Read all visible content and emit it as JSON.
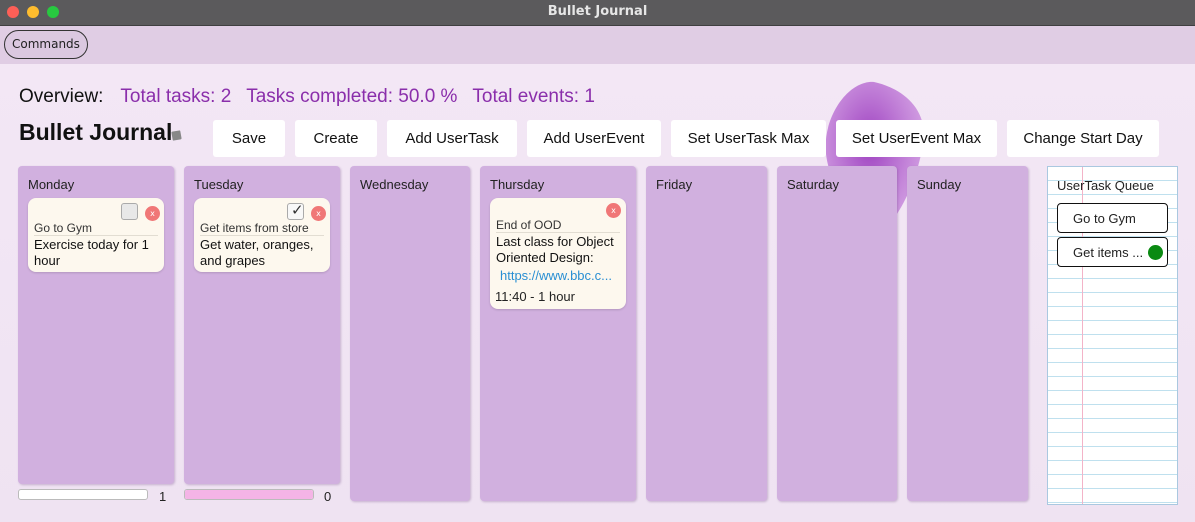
{
  "window": {
    "title": "Bullet Journal"
  },
  "menubar": {
    "commands_label": "Commands"
  },
  "overview": {
    "label": "Overview:",
    "total_tasks": "Total tasks: 2",
    "tasks_completed": "Tasks completed: 50.0 %",
    "total_events": "Total events: 1"
  },
  "journal": {
    "title": "Bullet Journal"
  },
  "toolbar": {
    "save": "Save",
    "create": "Create",
    "add_task": "Add UserTask",
    "add_event": "Add UserEvent",
    "set_task_max": "Set UserTask Max",
    "set_event_max": "Set UserEvent Max",
    "change_start_day": "Change Start Day"
  },
  "days": {
    "monday": {
      "name": "Monday",
      "task": {
        "title": "Go to Gym",
        "description": "Exercise today for 1 hour",
        "completed": false,
        "delete": "x"
      },
      "progress": {
        "fraction": 0.0,
        "count": "1"
      }
    },
    "tuesday": {
      "name": "Tuesday",
      "task": {
        "title": "Get items from store",
        "description": "Get water, oranges, and grapes",
        "completed": true,
        "check": "✓",
        "delete": "x"
      },
      "progress": {
        "fraction": 1.0,
        "count": "0"
      }
    },
    "wednesday": {
      "name": "Wednesday"
    },
    "thursday": {
      "name": "Thursday",
      "event": {
        "title": "End of OOD",
        "description": "Last class for Object Oriented Design:",
        "link": "https://www.bbc.c...",
        "time": "11:40 - 1 hour",
        "delete": "x"
      }
    },
    "friday": {
      "name": "Friday"
    },
    "saturday": {
      "name": "Saturday"
    },
    "sunday": {
      "name": "Sunday"
    }
  },
  "queue": {
    "title": "UserTask Queue",
    "items": [
      {
        "label": "Go to Gym",
        "status_color": "#ffffff"
      },
      {
        "label": "Get items ...",
        "status_color": "#0a8a12"
      }
    ]
  },
  "colors": {
    "accent": "#8a2eab",
    "column": "#d1b0df",
    "card": "#fdf8ee",
    "progress_fill": "#f4b4e6"
  }
}
